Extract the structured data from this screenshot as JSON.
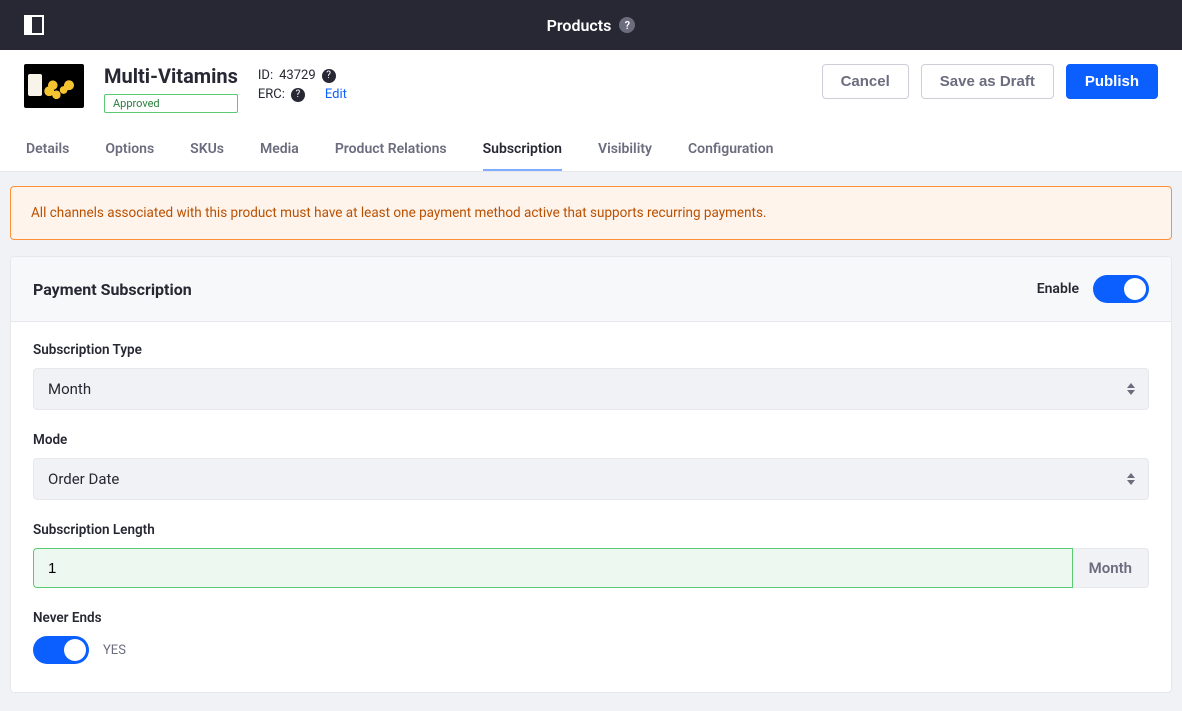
{
  "topbar": {
    "title": "Products"
  },
  "product": {
    "name": "Multi-Vitamins",
    "status": "Approved",
    "id_label": "ID:",
    "id_value": "43729",
    "erc_label": "ERC:",
    "edit": "Edit"
  },
  "buttons": {
    "cancel": "Cancel",
    "draft": "Save as Draft",
    "publish": "Publish"
  },
  "tabs": [
    "Details",
    "Options",
    "SKUs",
    "Media",
    "Product Relations",
    "Subscription",
    "Visibility",
    "Configuration"
  ],
  "active_tab": "Subscription",
  "alert": "All channels associated with this product must have at least one payment method active that supports recurring payments.",
  "card": {
    "title": "Payment Subscription",
    "enable_label": "Enable",
    "enabled": true,
    "subscription_type_label": "Subscription Type",
    "subscription_type_value": "Month",
    "mode_label": "Mode",
    "mode_value": "Order Date",
    "length_label": "Subscription Length",
    "length_value": "1",
    "length_unit": "Month",
    "never_ends_label": "Never Ends",
    "never_ends_value": "YES",
    "never_ends_on": true
  }
}
